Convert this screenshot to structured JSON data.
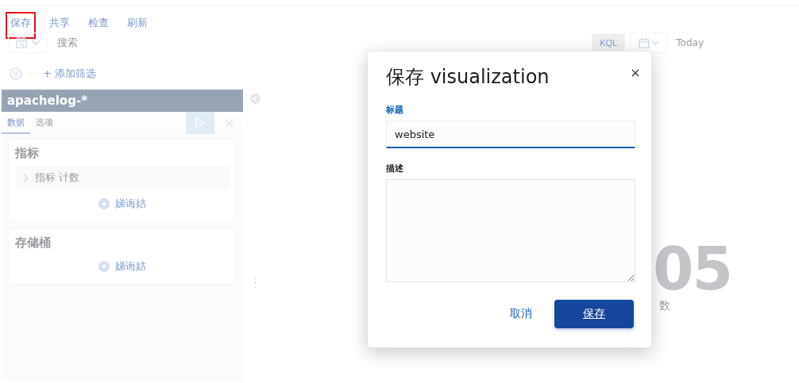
{
  "top_nav": [
    {
      "label": "保存",
      "highlighted": true
    },
    {
      "label": "共享",
      "highlighted": false
    },
    {
      "label": "检查",
      "highlighted": false
    },
    {
      "label": "刷新",
      "highlighted": false
    }
  ],
  "query_bar": {
    "placeholder": "搜索",
    "language": "KQL",
    "date": "Today"
  },
  "filter_bar": {
    "add_filter": "+ 添加筛选"
  },
  "editor": {
    "index_pattern": "apachelog-*",
    "tabs": [
      {
        "label": "数据",
        "selected": true
      },
      {
        "label": "选项",
        "selected": false
      }
    ],
    "sections": [
      {
        "title": "指标",
        "items": [
          {
            "label": "指标 计数",
            "expanded": false
          }
        ],
        "add": "娣诲姞"
      },
      {
        "title": "存储桶",
        "add": "娣诲姞"
      }
    ]
  },
  "metric": {
    "value": "05",
    "label": "数"
  },
  "dialog": {
    "title": "保存 visualization",
    "fields": [
      {
        "kind": "input",
        "label": "标题",
        "value": "website"
      },
      {
        "kind": "textarea",
        "label": "描述"
      }
    ],
    "buttons": [
      {
        "kind": "link",
        "label": "取消"
      },
      {
        "kind": "primary",
        "label": "保存"
      }
    ]
  }
}
